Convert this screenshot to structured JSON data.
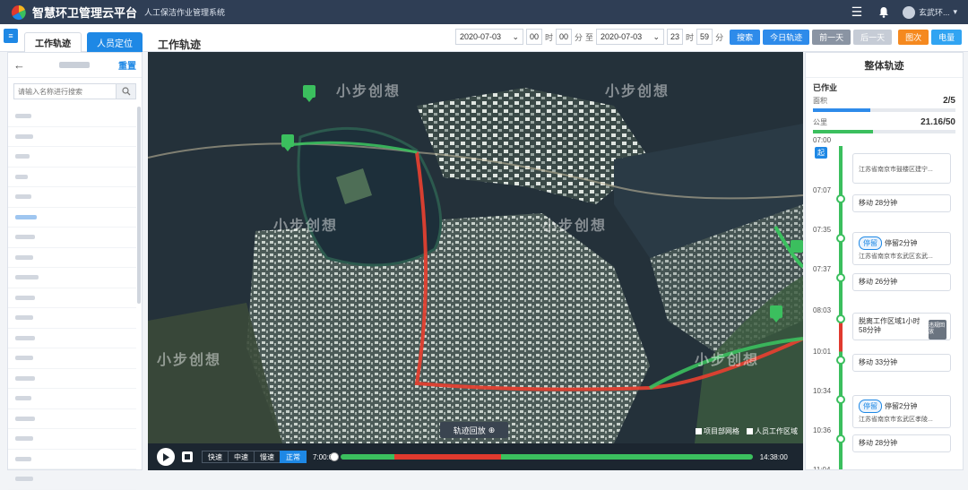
{
  "app": {
    "title": "智慧环卫管理云平台",
    "subtitle": "人工保洁作业管理系统",
    "user": "玄武环..."
  },
  "nav": {
    "tabs": [
      {
        "label": "工作轨迹",
        "active": true
      },
      {
        "label": "人员定位",
        "active": false
      }
    ],
    "page_title": "工作轨迹"
  },
  "filters": {
    "start_date": "2020-07-03",
    "start_hour": "00",
    "start_min": "00",
    "end_date": "2020-07-03",
    "end_hour": "23",
    "end_min": "59",
    "unit_hour": "时",
    "unit_min": "分",
    "unit_to": "至",
    "buttons": {
      "search": "搜索",
      "today": "今日轨迹",
      "prev_day": "前一天",
      "next_day": "后一天",
      "tag1": "图次",
      "tag2": "电量"
    }
  },
  "sidebar": {
    "reset": "重置",
    "search_placeholder": "请输入名称进行搜索",
    "list_count": 19,
    "active_index": 5
  },
  "map": {
    "watermark": "小步创想",
    "replay_button": "轨迹回放",
    "toggle_grid": "项目部网格",
    "toggle_area": "人员工作区域"
  },
  "player": {
    "speeds": [
      "快速",
      "中速",
      "慢速",
      "正常"
    ],
    "active_speed": "正常",
    "start_time": "7:00:00",
    "end_time": "14:38:00",
    "progress": 0.05,
    "colors": {
      "moving": "#3bbf5e",
      "stay": "#e03a2e"
    }
  },
  "panel": {
    "title": "整体轨迹",
    "done_label": "已作业",
    "area_label": "面积",
    "area_value": "2/5",
    "area_ratio": 0.4,
    "km_label": "公里",
    "km_value": "21.16/50",
    "km_ratio": 0.4232,
    "start_tag": "起",
    "times": [
      "07:00",
      "07:07",
      "07:35",
      "07:37",
      "08:03",
      "10:01",
      "10:34",
      "10:36",
      "11:04"
    ],
    "events": [
      {
        "badge": "",
        "text": "",
        "detail": "江苏省南京市鼓楼区建宁..."
      },
      {
        "badge": "",
        "text": "移动 28分钟",
        "detail": ""
      },
      {
        "badge": "停留",
        "text": "停留2分钟",
        "detail": "江苏省南京市玄武区玄武..."
      },
      {
        "badge": "",
        "text": "移动 26分钟",
        "detail": ""
      },
      {
        "badge": "",
        "text": "脱离工作区域1小时58分钟",
        "detail": "",
        "action": "违规回放"
      },
      {
        "badge": "",
        "text": "移动 33分钟",
        "detail": ""
      },
      {
        "badge": "停留",
        "text": "停留2分钟",
        "detail": "江苏省南京市玄武区孝陵..."
      },
      {
        "badge": "",
        "text": "移动 28分钟",
        "detail": ""
      }
    ]
  }
}
